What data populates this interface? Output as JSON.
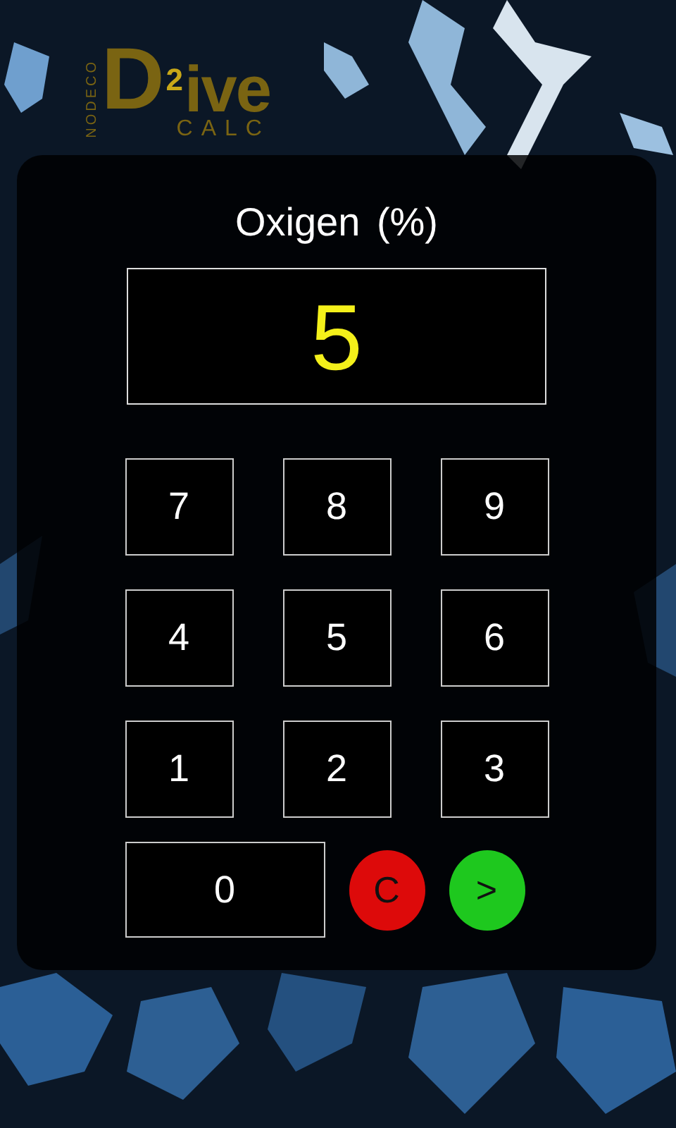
{
  "logo": {
    "side_text": "NODECO",
    "initial": "D",
    "digit": "2",
    "word": "ive",
    "subtitle": "CALC"
  },
  "dialog": {
    "title": "Oxigen (%)",
    "value": "5",
    "keys": [
      {
        "label": "7",
        "kind": "digit"
      },
      {
        "label": "8",
        "kind": "digit"
      },
      {
        "label": "9",
        "kind": "digit"
      },
      {
        "label": "4",
        "kind": "digit"
      },
      {
        "label": "5",
        "kind": "digit"
      },
      {
        "label": "6",
        "kind": "digit"
      },
      {
        "label": "1",
        "kind": "digit"
      },
      {
        "label": "2",
        "kind": "digit"
      },
      {
        "label": "3",
        "kind": "digit"
      },
      {
        "label": "0",
        "kind": "wide"
      },
      {
        "label": "C",
        "kind": "round",
        "color": "#dd0a0a"
      },
      {
        "label": ">",
        "kind": "round",
        "color": "#1ec81e"
      }
    ]
  }
}
